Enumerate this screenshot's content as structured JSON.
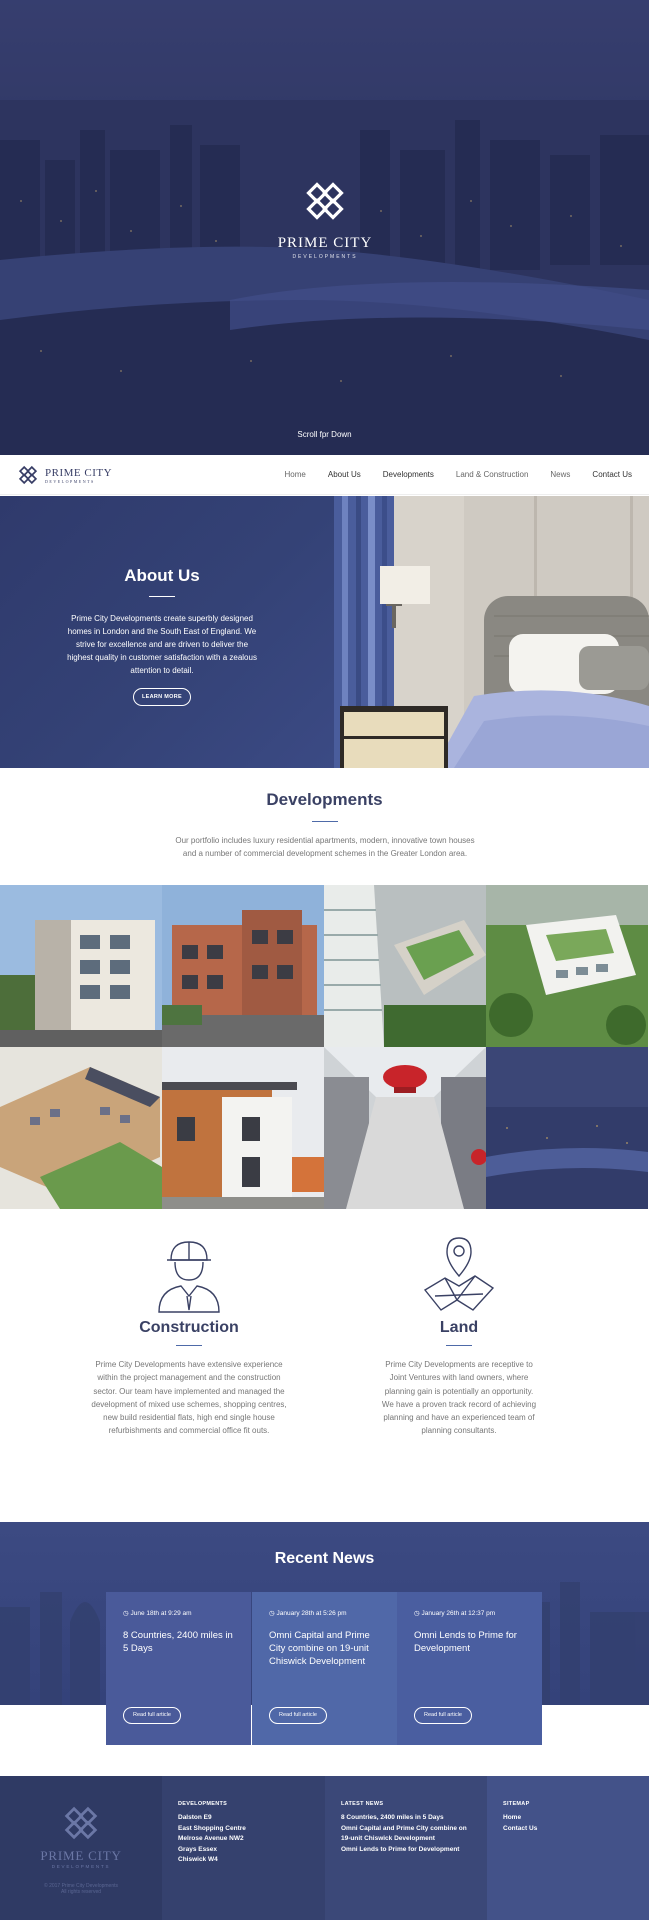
{
  "hero": {
    "brand": "PRIME CITY",
    "brand_sub": "DEVELOPMENTS",
    "scroll_label": "Scroll fpr Down"
  },
  "nav": {
    "brand": "PRIME CITY",
    "brand_sub": "DEVELOPMENTS",
    "links": [
      "Home",
      "About Us",
      "Developments",
      "Land & Construction",
      "News",
      "Contact Us"
    ]
  },
  "about": {
    "title": "About Us",
    "body": "Prime City Developments create superbly designed homes in London and the South East of England. We strive for excellence and are driven to deliver the highest quality in customer satisfaction with a zealous attention to detail.",
    "button": "LEARN MORE"
  },
  "developments": {
    "title": "Developments",
    "body": "Our portfolio includes luxury residential apartments, modern, innovative town houses and a number of commercial development schemes in the Greater London area."
  },
  "construction": {
    "title": "Construction",
    "body": "Prime City Developments have extensive experience within the project management and the construction sector. Our team have implemented and managed the development of mixed use schemes, shopping centres, new build residential flats, high end single house refurbishments and commercial office fit outs."
  },
  "land": {
    "title": "Land",
    "body": "Prime City Developments are receptive to Joint Ventures with land owners, where planning gain is potentially an opportunity. We have a proven track record of achieving planning and have an experienced team of planning consultants."
  },
  "news": {
    "title": "Recent News",
    "items": [
      {
        "date": "June 18th at 9:29 am",
        "title": "8 Countries, 2400 miles in 5 Days",
        "button": "Read full article"
      },
      {
        "date": "January 28th at 5:26 pm",
        "title": "Omni Capital and Prime City combine on 19-unit Chiswick Development",
        "button": "Read full article"
      },
      {
        "date": "January 26th at 12:37 pm",
        "title": "Omni Lends to Prime for Development",
        "button": "Read full article"
      }
    ]
  },
  "footer": {
    "brand": "PRIME CITY",
    "brand_sub": "DEVELOPMENTS",
    "copyright_1": "© 2017 Prime City Developments",
    "copyright_2": "All rights reserved",
    "developments_heading": "DEVELOPMENTS",
    "developments": [
      "Dalston E9",
      "East Shopping Centre",
      "Melrose Avenue NW2",
      "Grays Essex",
      "Chiswick W4"
    ],
    "news_heading": "LATEST NEWS",
    "news": [
      "8 Countries, 2400 miles in 5 Days",
      "Omni Capital and Prime City combine on 19-unit Chiswick Development",
      "Omni Lends to Prime for Development"
    ],
    "sitemap_heading": "SITEMAP",
    "sitemap": [
      "Home",
      "Contact Us"
    ]
  },
  "colors": {
    "navy": "#383e66",
    "accent": "#4e6aa8",
    "news_card_1": "#4a5a9a",
    "news_card_2": "#5068a8",
    "news_card_3": "#4a5ea0"
  }
}
